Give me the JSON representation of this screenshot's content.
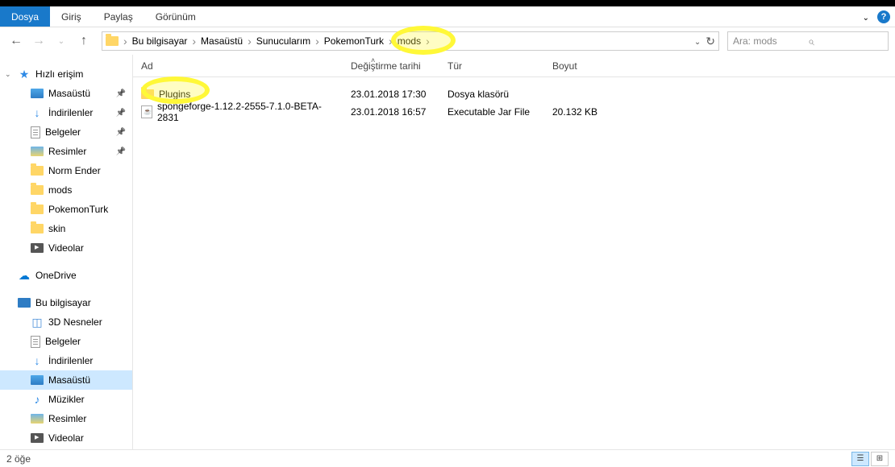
{
  "ribbon": {
    "tabs": [
      "Dosya",
      "Giriş",
      "Paylaş",
      "Görünüm"
    ]
  },
  "breadcrumb": {
    "items": [
      "Bu bilgisayar",
      "Masaüstü",
      "Sunucularım",
      "PokemonTurk",
      "mods"
    ]
  },
  "search": {
    "placeholder": "Ara: mods"
  },
  "sidebar": {
    "quick_access": "Hızlı erişim",
    "quick_items": [
      {
        "label": "Masaüstü",
        "icon": "desktop",
        "pinned": true
      },
      {
        "label": "İndirilenler",
        "icon": "download",
        "pinned": true
      },
      {
        "label": "Belgeler",
        "icon": "doc",
        "pinned": true
      },
      {
        "label": "Resimler",
        "icon": "pic",
        "pinned": true
      },
      {
        "label": "Norm Ender",
        "icon": "folder",
        "pinned": false
      },
      {
        "label": "mods",
        "icon": "folder",
        "pinned": false
      },
      {
        "label": "PokemonTurk",
        "icon": "folder",
        "pinned": false
      },
      {
        "label": "skin",
        "icon": "folder",
        "pinned": false
      },
      {
        "label": "Videolar",
        "icon": "video",
        "pinned": false
      }
    ],
    "onedrive": "OneDrive",
    "this_pc": "Bu bilgisayar",
    "pc_items": [
      {
        "label": "3D Nesneler",
        "icon": "3d"
      },
      {
        "label": "Belgeler",
        "icon": "doc"
      },
      {
        "label": "İndirilenler",
        "icon": "download"
      },
      {
        "label": "Masaüstü",
        "icon": "desktop",
        "selected": true
      },
      {
        "label": "Müzikler",
        "icon": "music"
      },
      {
        "label": "Resimler",
        "icon": "pic"
      },
      {
        "label": "Videolar",
        "icon": "video"
      }
    ]
  },
  "columns": {
    "name": "Ad",
    "date": "Değiştirme tarihi",
    "type": "Tür",
    "size": "Boyut"
  },
  "files": [
    {
      "name": "Plugins",
      "date": "23.01.2018 17:30",
      "type": "Dosya klasörü",
      "size": "",
      "icon": "folder"
    },
    {
      "name": "spongeforge-1.12.2-2555-7.1.0-BETA-2831",
      "date": "23.01.2018 16:57",
      "type": "Executable Jar File",
      "size": "20.132 KB",
      "icon": "jar"
    }
  ],
  "statusbar": {
    "count": "2 öğe"
  }
}
